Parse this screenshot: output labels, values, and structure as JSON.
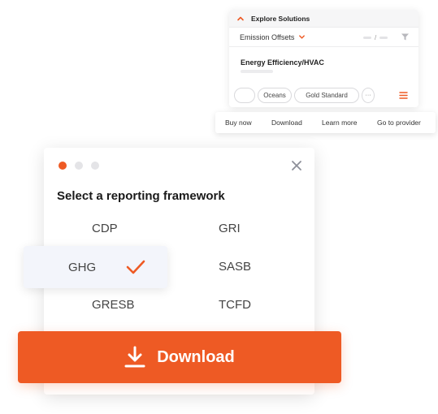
{
  "colors": {
    "accent": "#ee5a24",
    "dot_active": "#ee5a24",
    "dot_inactive": "#e4e4e7",
    "selected_bg": "#f3f5fb"
  },
  "explore": {
    "title": "Explore Solutions",
    "filter_label": "Emission Offsets",
    "pager_separator": "/",
    "item_title": "Energy Efficiency/HVAC",
    "chips": [
      "Oceans",
      "Gold Standard"
    ],
    "more_label": "···"
  },
  "actions": {
    "buy_now": "Buy now",
    "download": "Download",
    "learn_more": "Learn more",
    "go_to_provider": "Go to provider"
  },
  "framework": {
    "heading": "Select a reporting framework",
    "options": {
      "cdp": "CDP",
      "gri": "GRI",
      "ghg": "GHG",
      "sasb": "SASB",
      "gresb": "GRESB",
      "tcfd": "TCFD"
    },
    "selected": "GHG"
  },
  "download_button": {
    "label": "Download",
    "icon": "download-icon"
  }
}
